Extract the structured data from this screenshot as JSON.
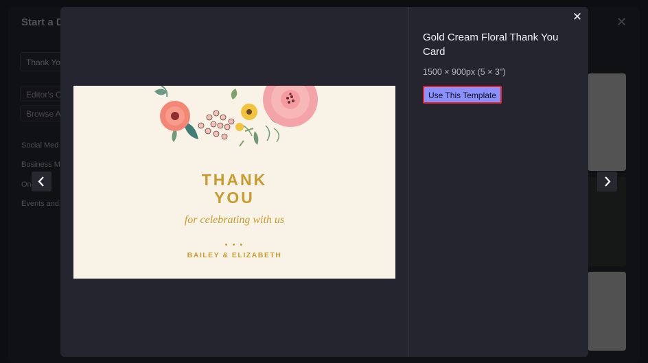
{
  "background": {
    "title": "Start a D",
    "search_value": "Thank Yo",
    "buttons": [
      "Editor's C",
      "Browse A"
    ],
    "categories": [
      "Social Med",
      "Business M",
      "Onl   dv",
      "Events and"
    ]
  },
  "modal": {
    "template_title": "Gold Cream Floral Thank You Card",
    "template_size": "1500 × 900px (5 × 3\")",
    "use_button_label": "Use This Template",
    "close_icon": "close-icon",
    "prev_icon": "chevron-left-icon",
    "next_icon": "chevron-right-icon"
  },
  "card": {
    "line1": "THANK",
    "line2": "YOU",
    "subtitle": "for celebrating with us",
    "dots": "• • •",
    "names": "BAILEY & ELIZABETH",
    "text_color": "#c99b2e",
    "bg_color": "#f8f3e6"
  },
  "colors": {
    "modal_bg": "#24252e",
    "button_bg": "#8b90ff",
    "button_border": "#e0262b"
  }
}
